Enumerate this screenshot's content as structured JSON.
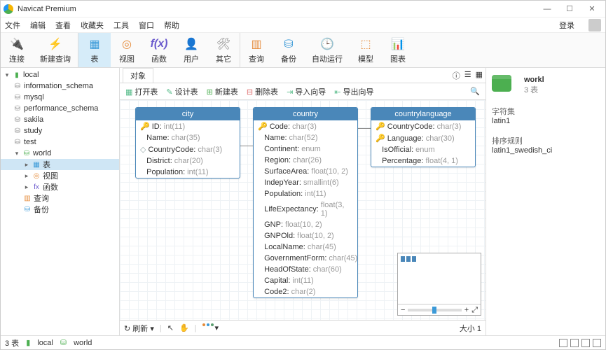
{
  "window": {
    "title": "Navicat Premium"
  },
  "menu": {
    "items": [
      "文件",
      "编辑",
      "查看",
      "收藏夹",
      "工具",
      "窗口",
      "帮助"
    ],
    "login": "登录"
  },
  "toolbar": {
    "items": [
      "连接",
      "新建查询",
      "表",
      "视图",
      "函数",
      "用户",
      "其它",
      "查询",
      "备份",
      "自动运行",
      "模型",
      "图表"
    ]
  },
  "tree": {
    "root": "local",
    "dbs": [
      "information_schema",
      "mysql",
      "performance_schema",
      "sakila",
      "study",
      "test",
      "world"
    ],
    "world_children": [
      "表",
      "视图",
      "函数",
      "查询",
      "备份"
    ]
  },
  "tabs": {
    "objects": "对象"
  },
  "subtoolbar": {
    "items": [
      "打开表",
      "设计表",
      "新建表",
      "删除表",
      "导入向导",
      "导出向导"
    ]
  },
  "chart_data": {
    "type": "table",
    "entities": [
      {
        "name": "city",
        "columns": [
          {
            "key": "pk",
            "name": "ID",
            "type": "int(11)"
          },
          {
            "key": "",
            "name": "Name",
            "type": "char(35)"
          },
          {
            "key": "fk",
            "name": "CountryCode",
            "type": "char(3)"
          },
          {
            "key": "",
            "name": "District",
            "type": "char(20)"
          },
          {
            "key": "",
            "name": "Population",
            "type": "int(11)"
          }
        ]
      },
      {
        "name": "country",
        "columns": [
          {
            "key": "pk",
            "name": "Code",
            "type": "char(3)"
          },
          {
            "key": "",
            "name": "Name",
            "type": "char(52)"
          },
          {
            "key": "",
            "name": "Continent",
            "type": "enum"
          },
          {
            "key": "",
            "name": "Region",
            "type": "char(26)"
          },
          {
            "key": "",
            "name": "SurfaceArea",
            "type": "float(10, 2)"
          },
          {
            "key": "",
            "name": "IndepYear",
            "type": "smallint(6)"
          },
          {
            "key": "",
            "name": "Population",
            "type": "int(11)"
          },
          {
            "key": "",
            "name": "LifeExpectancy",
            "type": "float(3, 1)"
          },
          {
            "key": "",
            "name": "GNP",
            "type": "float(10, 2)"
          },
          {
            "key": "",
            "name": "GNPOld",
            "type": "float(10, 2)"
          },
          {
            "key": "",
            "name": "LocalName",
            "type": "char(45)"
          },
          {
            "key": "",
            "name": "GovernmentForm",
            "type": "char(45)"
          },
          {
            "key": "",
            "name": "HeadOfState",
            "type": "char(60)"
          },
          {
            "key": "",
            "name": "Capital",
            "type": "int(11)"
          },
          {
            "key": "",
            "name": "Code2",
            "type": "char(2)"
          }
        ]
      },
      {
        "name": "countrylanguage",
        "columns": [
          {
            "key": "pk",
            "name": "CountryCode",
            "type": "char(3)"
          },
          {
            "key": "pk",
            "name": "Language",
            "type": "char(30)"
          },
          {
            "key": "",
            "name": "IsOfficial",
            "type": "enum"
          },
          {
            "key": "",
            "name": "Percentage",
            "type": "float(4, 1)"
          }
        ]
      }
    ],
    "relations": [
      {
        "from": "city.CountryCode",
        "to": "country.Code"
      },
      {
        "from": "countrylanguage.CountryCode",
        "to": "country.Code"
      }
    ]
  },
  "detail": {
    "name": "workl",
    "sub": "3 表",
    "charset_lbl": "字符集",
    "charset": "latin1",
    "collation_lbl": "排序规则",
    "collation": "latin1_swedish_ci"
  },
  "bottom": {
    "refresh": "刷新",
    "size": "大小 1"
  },
  "status": {
    "left": "3 表",
    "conn": "local",
    "db": "world"
  }
}
